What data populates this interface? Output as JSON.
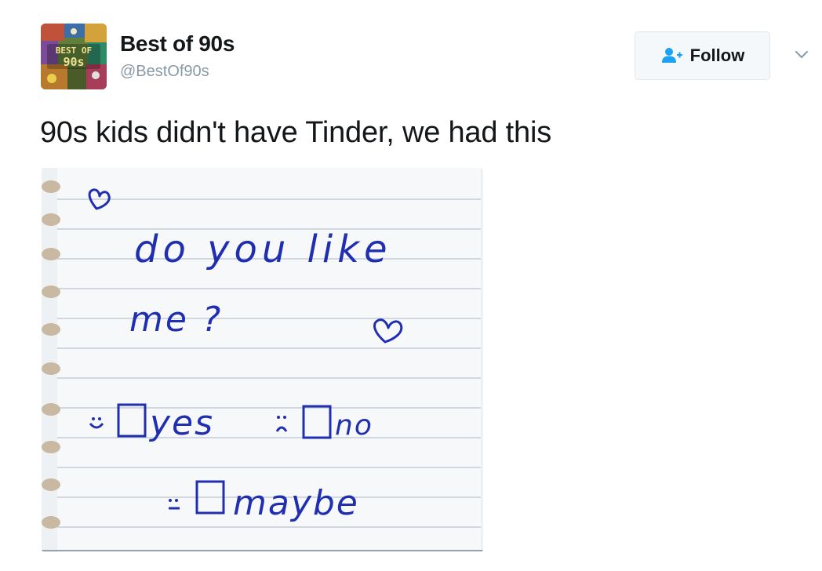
{
  "tweet": {
    "display_name": "Best of 90s",
    "handle": "@BestOf90s",
    "text": "90s kids didn't have Tinder, we had this"
  },
  "avatar": {
    "label_line1": "BEST OF",
    "label_line2": "90s"
  },
  "follow": {
    "label": "Follow"
  },
  "note": {
    "line1": "do you like",
    "line2": "me ?",
    "option_yes": "yes",
    "option_no": "no",
    "option_maybe": "maybe"
  },
  "colors": {
    "ink": "#1f2fb0",
    "text": "#14171a",
    "muted": "#8899a6",
    "accent": "#1da1f2"
  },
  "icons": {
    "follow": "follow-person-plus-icon",
    "more": "chevron-down-icon"
  }
}
